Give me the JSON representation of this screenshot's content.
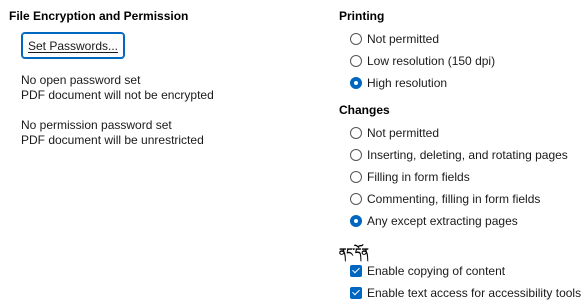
{
  "encryption": {
    "heading": "File Encryption and Permission",
    "set_passwords_label": "Set Passwords...",
    "open_password_status": "No open password set",
    "encryption_status": "PDF document will not be encrypted",
    "permission_password_status": "No permission password set",
    "restriction_status": "PDF document will be unrestricted"
  },
  "printing": {
    "heading": "Printing",
    "options": [
      {
        "label": "Not permitted",
        "selected": false
      },
      {
        "label": "Low resolution (150 dpi)",
        "selected": false
      },
      {
        "label": "High resolution",
        "selected": true
      }
    ]
  },
  "changes": {
    "heading": "Changes",
    "options": [
      {
        "label": "Not permitted",
        "selected": false
      },
      {
        "label": "Inserting, deleting, and rotating pages",
        "selected": false
      },
      {
        "label": "Filling in form fields",
        "selected": false
      },
      {
        "label": "Commenting, filling in form fields",
        "selected": false
      },
      {
        "label": "Any except extracting pages",
        "selected": true
      }
    ]
  },
  "content": {
    "heading": "ནང་དོན",
    "options": [
      {
        "label": "Enable copying of content",
        "checked": true
      },
      {
        "label": "Enable text access for accessibility tools",
        "checked": true
      }
    ]
  },
  "colors": {
    "accent": "#0067c0"
  }
}
